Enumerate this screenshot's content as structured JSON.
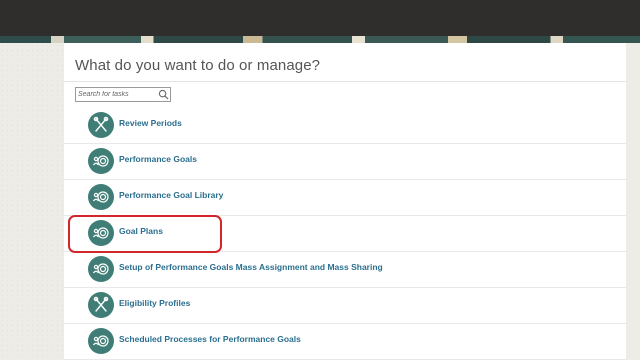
{
  "header": {
    "title": "What do you want to do or manage?"
  },
  "search": {
    "placeholder": "Search for tasks"
  },
  "tasks": [
    {
      "label": "Review Periods",
      "icon": "scissors-tools-icon"
    },
    {
      "label": "Performance Goals",
      "icon": "target-people-icon"
    },
    {
      "label": "Performance Goal Library",
      "icon": "target-people-icon"
    },
    {
      "label": "Goal Plans",
      "icon": "target-people-icon",
      "highlighted": true
    },
    {
      "label": "Setup of Performance Goals Mass Assignment and Mass Sharing",
      "icon": "target-people-icon"
    },
    {
      "label": "Eligibility Profiles",
      "icon": "scissors-tools-icon"
    },
    {
      "label": "Scheduled Processes for Performance Goals",
      "icon": "target-people-icon"
    }
  ],
  "colors": {
    "accent_teal": "#3f7d76",
    "link_blue": "#2a6f8f",
    "highlight_red": "#d1262b"
  }
}
